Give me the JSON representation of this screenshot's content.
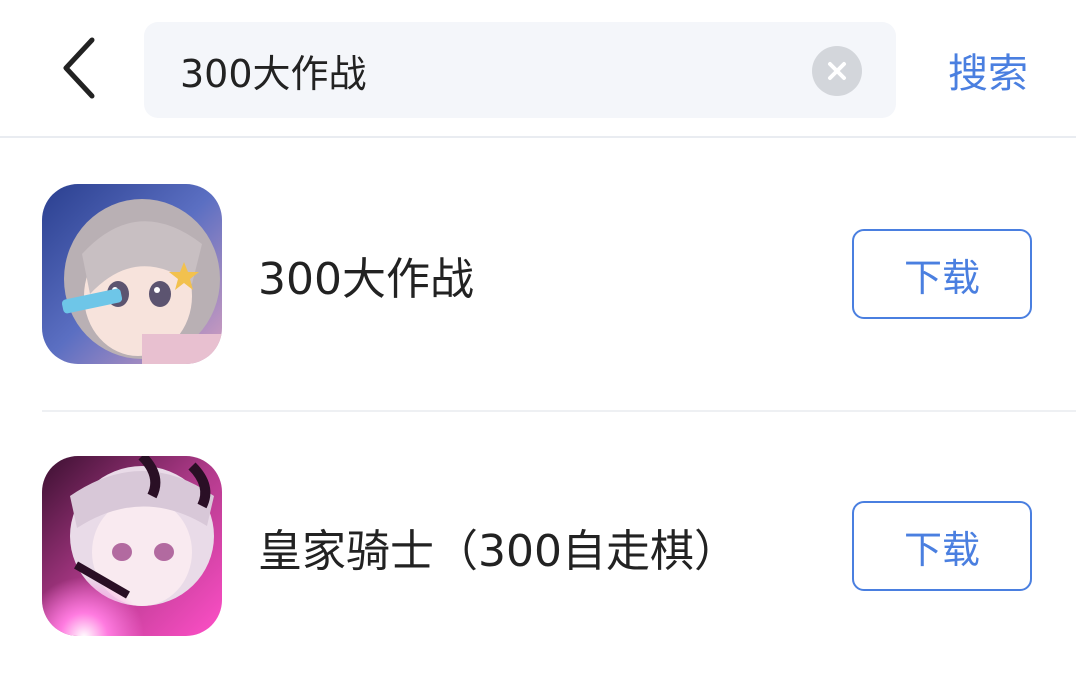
{
  "colors": {
    "accent": "#4a7fe0",
    "text_primary": "#222222",
    "search_bg": "#f4f6fa",
    "clear_icon_bg": "#d3d6db",
    "divider": "#e9ecf1"
  },
  "header": {
    "back_icon": "chevron-left-icon",
    "search": {
      "value": "300大作战",
      "placeholder": "",
      "clear_icon": "close-circle-icon"
    },
    "search_button_label": "搜索"
  },
  "results": [
    {
      "name": "300大作战",
      "icon": "app-icon-anime-girl-blue",
      "download_label": "下载"
    },
    {
      "name": "皇家骑士（300自走棋）",
      "icon": "app-icon-anime-girl-pink",
      "download_label": "下载"
    }
  ]
}
